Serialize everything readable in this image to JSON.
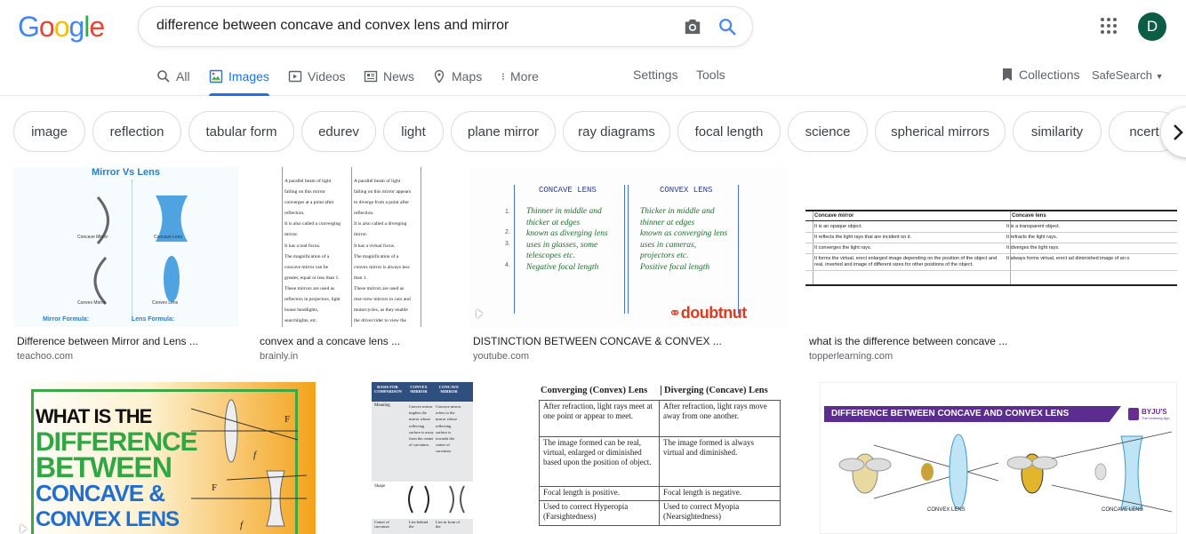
{
  "logo": {
    "letters": [
      "G",
      "o",
      "o",
      "g",
      "l",
      "e"
    ]
  },
  "search": {
    "query": "difference between concave and convex lens and mirror"
  },
  "account": {
    "initial": "D"
  },
  "tabs": [
    {
      "label": "All",
      "icon": "search-icon"
    },
    {
      "label": "Images",
      "icon": "image-icon",
      "active": true
    },
    {
      "label": "Videos",
      "icon": "video-icon"
    },
    {
      "label": "News",
      "icon": "news-icon"
    },
    {
      "label": "Maps",
      "icon": "map-pin-icon"
    },
    {
      "label": "More",
      "icon": "more-vert-icon"
    }
  ],
  "tools": {
    "settings": "Settings",
    "tools": "Tools",
    "collections": "Collections",
    "safesearch": "SafeSearch"
  },
  "chips": [
    "image",
    "reflection",
    "tabular form",
    "edurev",
    "light",
    "plane mirror",
    "ray diagrams",
    "focal length",
    "science",
    "spherical mirrors",
    "similarity",
    "ncert"
  ],
  "results": [
    {
      "title": "Difference between Mirror and Lens ...",
      "source": "teachoo.com",
      "thumb": {
        "heading": "Mirror Vs Lens",
        "label1": "Concave Mirror",
        "label2": "Concave Lens",
        "label3": "Convex Mirror",
        "label4": "Convex Lens",
        "mirror_formula": "Mirror Formula:",
        "lens_formula": "Lens Formula:"
      }
    },
    {
      "title": "convex and a concave lens ...",
      "source": "brainly.in",
      "thumb": {
        "left": [
          "A parallel beam of light",
          "falling on this mirror",
          "converges at a point after",
          "reflection.",
          "It is also called a converging",
          "mirror.",
          "It has a real focus.",
          "The magnification of a",
          "concave mirror can be",
          "greater, equal or less than 1.",
          "These mirrors are used as",
          "reflectors in projectors, light",
          "house headlights,",
          "searchlights, etc."
        ],
        "right": [
          "A parallel beam of light",
          "falling on this mirror appears",
          "to diverge from a point after",
          "reflection.",
          "It is also called a diverging",
          "mirror.",
          "It has a virtual focus.",
          "The magnification of a",
          "convex mirror is always less",
          "than 1.",
          "These mirrors are used as",
          "rear-view mirrors in cars and",
          "motorcycles, as they enable",
          "the driver/rider to view the"
        ]
      }
    },
    {
      "title": "DISTINCTION BETWEEN CONCAVE & CONVEX ...",
      "source": "youtube.com",
      "thumb": {
        "col1": "CONCAVE LENS",
        "col2": "CONVEX LENS",
        "left_lines": [
          "Thinner in middle and",
          "thicker at edges",
          "known as diverging lens",
          "uses in glasses, some",
          "telescopes etc.",
          "Negative focal length"
        ],
        "right_lines": [
          "Thicker in middle and",
          "thinner at edges",
          "known as converging lens",
          "uses in cameras,",
          "projectors etc.",
          "Positive focal length"
        ],
        "nums": [
          "1.",
          "2.",
          "3.",
          "4."
        ],
        "brand": "doubtnut"
      }
    },
    {
      "title": "what is the difference between concave ...",
      "source": "topperlearning.com",
      "thumb": {
        "h1": "Concave mirror",
        "h2": "Concave lens",
        "rows": [
          [
            "It is an opaque object.",
            "It is a transparent object."
          ],
          [
            "It reflects the light rays that are incident on it.",
            "It refracts the light rays."
          ],
          [
            "It converges the light rays.",
            "It diverges the light rays."
          ],
          [
            "It forms the virtual, erect enlarged image depending on the position of the object and real, inverted and image of different sizes for other positions of the object.",
            "It always forms virtual, erect ad diminished image of an o"
          ]
        ]
      }
    },
    {
      "title": "",
      "source": "",
      "thumb": {
        "lines": [
          "WHAT IS THE",
          "DIFFERENCE",
          "BETWEEN",
          "CONCAVE &",
          "CONVEX LENS"
        ],
        "f": "f",
        "F": "F"
      }
    },
    {
      "title": "",
      "source": "",
      "thumb": {
        "h1": "BASIS FOR COMPARISON",
        "h2": "CONVEX MIRROR",
        "h3": "CONCAVE MIRROR",
        "r1": "Meaning",
        "r1a": "Convex mirror implies the mirror whose reflecting surface is away from the center of curvature.",
        "r1b": "Concave mirror refers to the mirror whose reflecting surface is towards the center of curvature.",
        "r2": "Shape",
        "r3": "Center of curvature",
        "r3a": "Lies behind the",
        "r3b": "Lies in front of the"
      }
    },
    {
      "title": "",
      "source": "",
      "thumb": {
        "h1": "Converging (Convex) Lens",
        "h2": "Diverging (Concave) Lens",
        "rows": [
          [
            "After refraction, light rays meet at one point or appear to meet.",
            "After refraction, light rays move away from one another."
          ],
          [
            "The image formed can be real, virtual, enlarged or diminished based upon the position of object.",
            "The image formed is always virtual and diminished."
          ],
          [
            "Focal length is positive.",
            "Focal length is negative."
          ],
          [
            "Used to correct Hyperopia (Farsightedness)",
            "Used to correct Myopia (Nearsightedness)"
          ]
        ]
      }
    },
    {
      "title": "",
      "source": "",
      "thumb": {
        "banner": "DIFFERENCE BETWEEN CONCAVE AND CONVEX LENS",
        "brand": "BYJU'S",
        "brand_sub": "The Learning App",
        "label1": "CONVEX LENS",
        "label2": "CONCAVE LENS"
      }
    }
  ]
}
